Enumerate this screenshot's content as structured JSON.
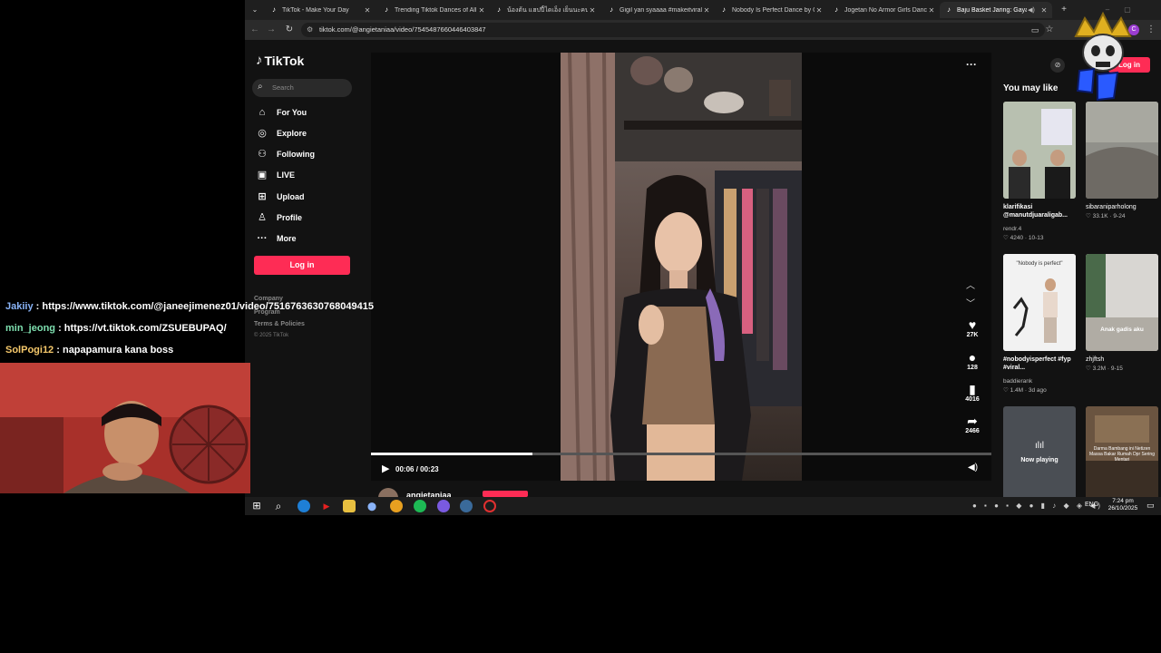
{
  "browser": {
    "tabs": [
      {
        "label": "TikTok - Make Your Day",
        "active": false
      },
      {
        "label": "Trending Tiktok Dances of All",
        "active": false
      },
      {
        "label": "น้องต้น แฮปปี้ไดเอ็ง เย็นนะคนดอมสนุก",
        "active": false
      },
      {
        "label": "Gigil yan syaaaa #makeitviral |",
        "active": false
      },
      {
        "label": "Nobody Is Perfect Dance by Cr",
        "active": false
      },
      {
        "label": "Jogetan No Armor Girls Dance",
        "active": false
      },
      {
        "label": "Baju Basket Jaring: Gaya An",
        "active": true
      }
    ],
    "new_tab_label": "+",
    "url": "tiktok.com/@angietaniaa/video/7545487660446403847",
    "profile_initial": "C"
  },
  "tiktok": {
    "logo_text": "TikTok",
    "search_placeholder": "Search",
    "nav": [
      {
        "label": "For You",
        "icon": "home-icon"
      },
      {
        "label": "Explore",
        "icon": "compass-icon"
      },
      {
        "label": "Following",
        "icon": "following-icon"
      },
      {
        "label": "LIVE",
        "icon": "live-icon"
      },
      {
        "label": "Upload",
        "icon": "upload-icon"
      },
      {
        "label": "Profile",
        "icon": "profile-icon"
      },
      {
        "label": "More",
        "icon": "more-icon"
      }
    ],
    "login_label": "Log in",
    "footer": {
      "company": "Company",
      "program": "Program",
      "terms": "Terms & Policies",
      "copyright": "© 2025 TikTok"
    },
    "top_login_label": "Log in",
    "video": {
      "current_time": "00:06",
      "duration": "00:23",
      "progress": 0.26,
      "author": "angietaniaa",
      "likes": "27K",
      "comments": "128",
      "saves": "4016",
      "shares": "2466"
    },
    "you_may_like": {
      "title": "You may like",
      "items": [
        {
          "caption": "klarifikasi @manutdjuaraligab...",
          "author": "rendr.4",
          "likes": "4240",
          "date": "10-13"
        },
        {
          "caption": "sibaraniparholong",
          "author": "",
          "likes": "33.1K",
          "date": "9-24"
        },
        {
          "caption": "#nobodyisperfect #fyp #viral...",
          "author": "baddierank",
          "likes": "1.4M",
          "date": "3d ago",
          "overlay": "\"Nobody is perfect\""
        },
        {
          "caption": "zhjftsh",
          "author": "",
          "likes": "3.2M",
          "date": "9-15",
          "overlay": "Anak gadis aku"
        },
        {
          "caption": "",
          "author": "",
          "likes": "",
          "date": "",
          "overlay": "Now playing"
        },
        {
          "caption": "",
          "author": "",
          "likes": "",
          "date": "",
          "overlay": "Darma Bambang ini Netizen Massa Bakar Rumah Dpr Sering Mentari"
        }
      ]
    }
  },
  "chat": [
    {
      "user": "Jakiiy",
      "message": "https://www.tiktok.com/@janeejimenez01/video/7516763630768049415",
      "color": "#8ab4f8"
    },
    {
      "user": "min_jeong",
      "message": "https://vt.tiktok.com/ZSUEBUPAQ/",
      "color": "#7ee0b0"
    },
    {
      "user": "SolPogi12",
      "message": "napapamura kana boss",
      "color": "#f5c86b"
    }
  ],
  "taskbar": {
    "language": "ENG",
    "time": "7:24 pm",
    "date": "26/10/2025"
  },
  "colors": {
    "tiktok_red": "#fe2c55",
    "background": "#121212"
  }
}
